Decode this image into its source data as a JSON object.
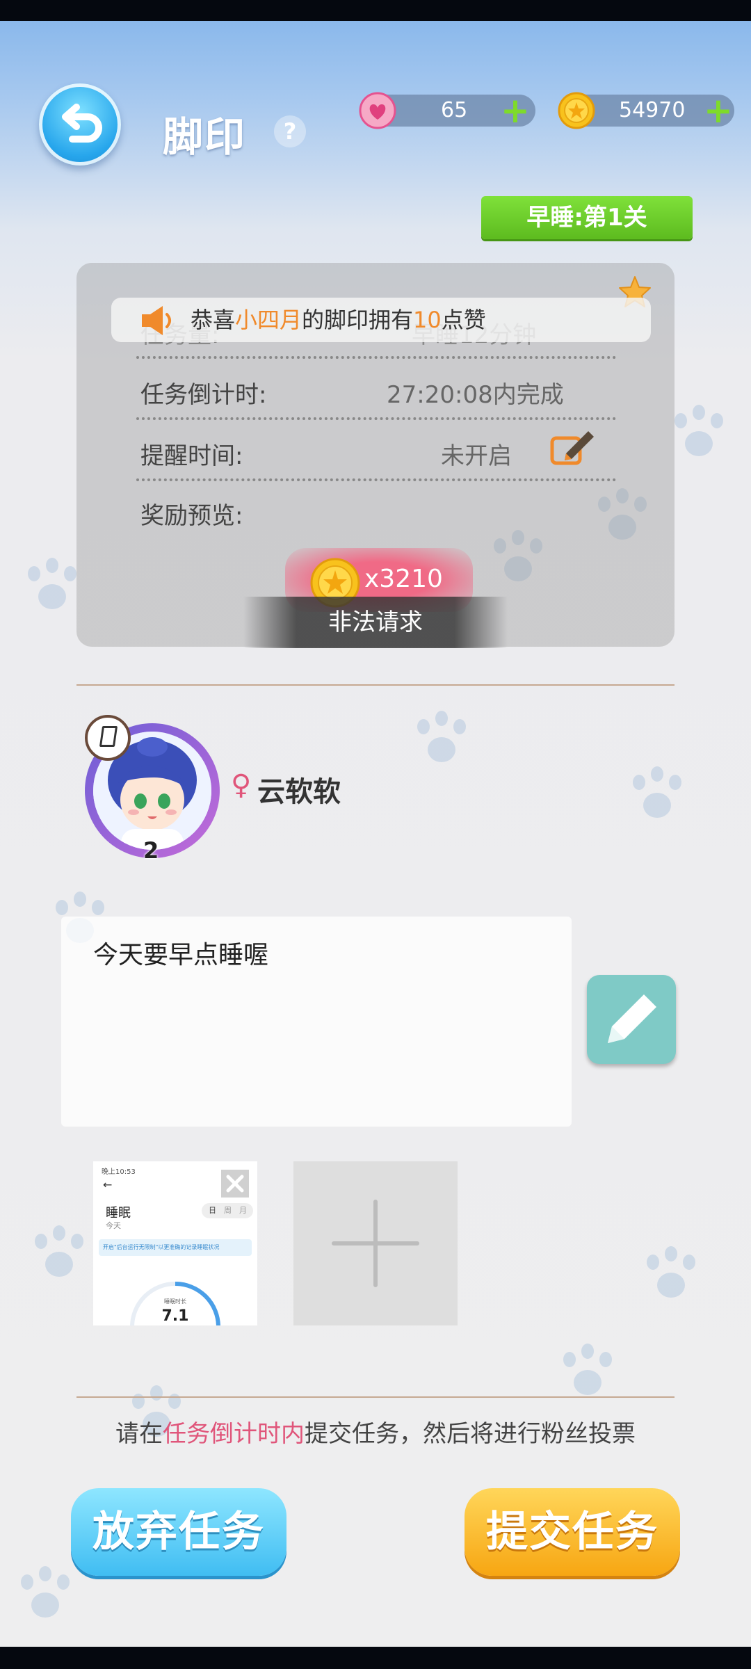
{
  "header": {
    "title": "脚印",
    "help_icon": "question-icon",
    "hearts": "65",
    "coins": "54970",
    "plus_symbol": "+"
  },
  "level_badge": "早睡:第1关",
  "ticker": {
    "prefix": "恭喜",
    "name": "小四月",
    "middle": "的脚印拥有",
    "count": "10",
    "suffix": "点赞",
    "highlight_color": "#f08a2b"
  },
  "task": {
    "amount_label": "任务量:",
    "amount_value": "早睡12分钟",
    "countdown_label": "任务倒计时:",
    "countdown_value": "27:20:08内完成",
    "reminder_label": "提醒时间:",
    "reminder_value": "未开启",
    "reward_label": "奖励预览:",
    "reward_value": "x3210",
    "error_text": "非法请求"
  },
  "user": {
    "gender_symbol": "♀",
    "name": "云软软",
    "level": "2",
    "badge_symbol": "0"
  },
  "note": {
    "text": "今天要早点睡喔"
  },
  "thumbnail": {
    "time": "晚上10:53",
    "title": "睡眠",
    "subtitle": "今天",
    "tabs": [
      "日",
      "周",
      "月"
    ],
    "notice": "开启\"后台运行无限制\"以更准确的记录睡眠状况",
    "chart_label": "睡眠时长",
    "chart_value": "7.1"
  },
  "hint": {
    "prefix": "请在",
    "highlight": "任务倒计时内",
    "suffix": "提交任务，然后将进行粉丝投票",
    "highlight_color": "#e0557a"
  },
  "buttons": {
    "give_up": "放弃任务",
    "submit": "提交任务"
  }
}
